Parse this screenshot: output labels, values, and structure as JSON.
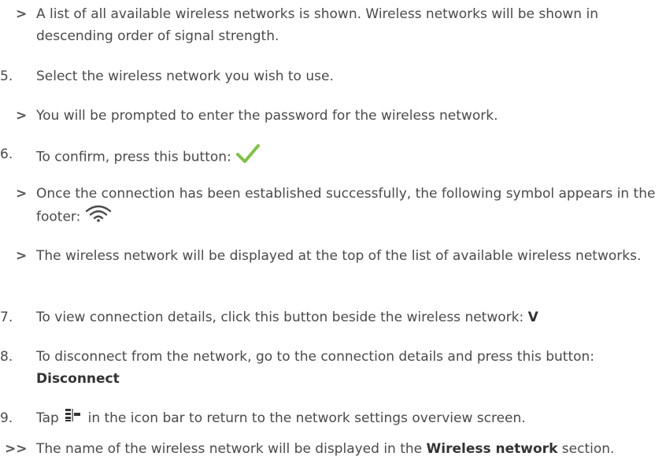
{
  "steps": [
    {
      "marker": ">",
      "text": "A list of all available wireless networks is shown. Wireless networks will be shown in descending order of signal strength."
    },
    {
      "marker": "5.",
      "text": "Select the wireless network you wish to use."
    },
    {
      "marker": ">",
      "text": "You will be prompted to enter the password for the wireless network."
    },
    {
      "marker": "6.",
      "text": "To confirm, press this button:",
      "icon": "checkmark-icon"
    },
    {
      "marker": ">",
      "text": "Once the connection has been established successfully, the following symbol appears in the footer:",
      "icon": "wifi-icon"
    },
    {
      "marker": ">",
      "text": "The wireless network will be displayed at the top of the list of available wireless networks."
    },
    {
      "marker": "7.",
      "text": "To view connection details, click this button beside the wireless network:",
      "bold": "V"
    },
    {
      "marker": "8.",
      "text": "To disconnect from the network, go to the connection details and press this button:",
      "bold": "Disconnect"
    },
    {
      "marker": "9.",
      "text_before": "Tap",
      "text_after": "in the icon bar to return to the network settings overview screen.",
      "icon": "network-settings-icon"
    },
    {
      "marker": ">>",
      "text_before": "The name of the wireless network will be displayed in the",
      "bold": "Wireless network",
      "text_after": "section."
    }
  ],
  "colors": {
    "text": "#4a4a4a",
    "check": "#7dc242",
    "wifi": "#4a4a4a"
  }
}
